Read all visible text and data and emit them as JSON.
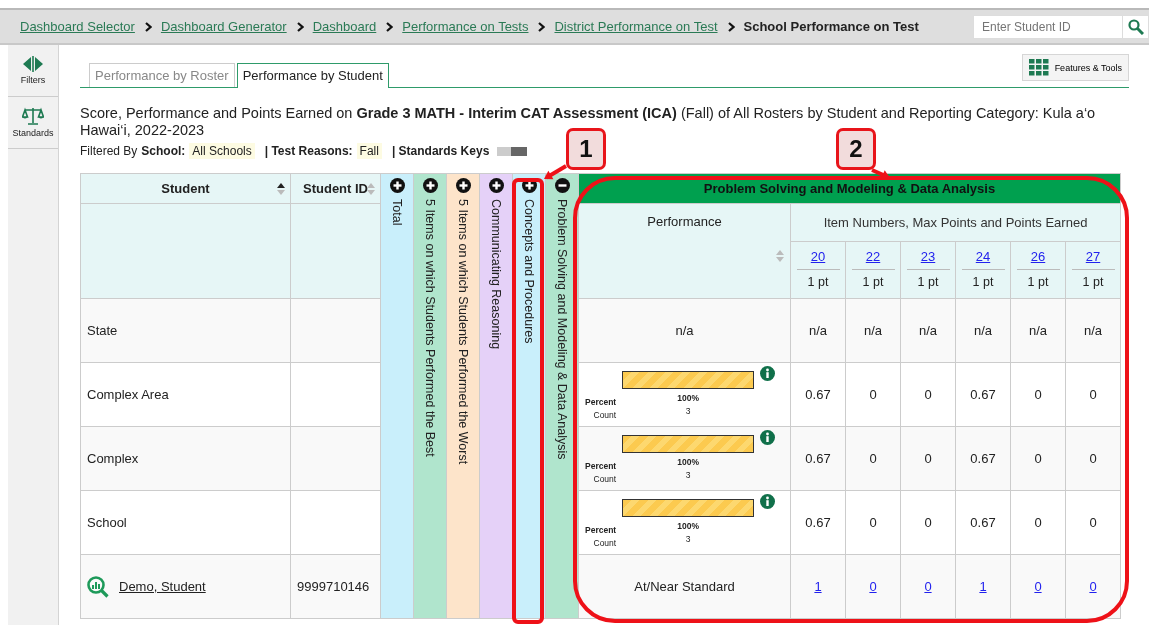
{
  "breadcrumbs": [
    {
      "label": "Dashboard Selector",
      "current": false
    },
    {
      "label": "Dashboard Generator",
      "current": false
    },
    {
      "label": "Dashboard",
      "current": false
    },
    {
      "label": "Performance on Tests",
      "current": false
    },
    {
      "label": "District Performance on Test",
      "current": false
    },
    {
      "label": "School Performance on Test",
      "current": true
    }
  ],
  "search": {
    "placeholder": "Enter Student ID"
  },
  "sidebar": {
    "items": [
      {
        "label": "Filters"
      },
      {
        "label": "Standards"
      }
    ]
  },
  "tabs": [
    {
      "label": "Performance by Roster",
      "selected": false
    },
    {
      "label": "Performance by Student",
      "selected": true
    }
  ],
  "features_button": {
    "label": "Features & Tools"
  },
  "title": "Score, Performance and Points Earned on **Grade 3 MATH - Interim CAT Assessment (ICA)** (Fall) of All Rosters by Student and Reporting Category: Kula a‘o Hawai‘i, 2022-2023",
  "filters": {
    "prefix": "Filtered By",
    "items": [
      {
        "label": "School:",
        "value": "All Schools"
      },
      {
        "label": "| Test Reasons:",
        "value": "Fall"
      }
    ],
    "standards_keys": {
      "label": "| Standards Keys",
      "on": false
    }
  },
  "table": {
    "columns": [
      {
        "label": "Student",
        "sorted": true
      },
      {
        "label": "Student ID",
        "sorted": false
      }
    ],
    "categories": [
      {
        "label": "Total",
        "color": "#c9effb",
        "expanded": false
      },
      {
        "label": "5 Items on which Students Performed the Best",
        "color": "#b0e5cd",
        "expanded": false
      },
      {
        "label": "5 Items on which Students Performed the Worst",
        "color": "#fde4ca",
        "expanded": false
      },
      {
        "label": "Communicating Reasoning",
        "color": "#e5d1f8",
        "expanded": false
      },
      {
        "label": "Concepts and Procedures",
        "color": "#c9effb",
        "expanded": false
      },
      {
        "label": "Problem Solving and Modeling & Data Analysis",
        "color": "#b0e5cd",
        "expanded": true
      }
    ],
    "group": {
      "title": "Problem Solving and Modeling & Data Analysis",
      "performance_header": {
        "label": "Performance",
        "sorted": false
      },
      "items_header": "Item Numbers, Max Points and Points Earned",
      "items": [
        {
          "number": "20",
          "points": "1 pt"
        },
        {
          "number": "22",
          "points": "1 pt"
        },
        {
          "number": "23",
          "points": "1 pt"
        },
        {
          "number": "24",
          "points": "1 pt"
        },
        {
          "number": "26",
          "points": "1 pt"
        },
        {
          "number": "27",
          "points": "1 pt"
        }
      ]
    },
    "rows": [
      {
        "kind": "aggregate",
        "name": "State",
        "performance": {
          "kind": "text",
          "text": "n/a"
        },
        "items": [
          "n/a",
          "n/a",
          "n/a",
          "n/a",
          "n/a",
          "n/a"
        ]
      },
      {
        "kind": "aggregate",
        "name": "Complex Area",
        "performance": {
          "kind": "bar",
          "level": 1,
          "percent_label": "Percent",
          "percent": "100%",
          "count_label": "Count",
          "count": "3"
        },
        "items": [
          "0.67",
          "0",
          "0",
          "0.67",
          "0",
          "0"
        ]
      },
      {
        "kind": "aggregate",
        "name": "Complex",
        "performance": {
          "kind": "bar",
          "level": 1,
          "percent_label": "Percent",
          "percent": "100%",
          "count_label": "Count",
          "count": "3"
        },
        "items": [
          "0.67",
          "0",
          "0",
          "0.67",
          "0",
          "0"
        ]
      },
      {
        "kind": "aggregate",
        "name": "School",
        "performance": {
          "kind": "bar",
          "level": 1,
          "percent_label": "Percent",
          "percent": "100%",
          "count_label": "Count",
          "count": "3"
        },
        "items": [
          "0.67",
          "0",
          "0",
          "0.67",
          "0",
          "0"
        ]
      },
      {
        "kind": "student",
        "name": "Demo, Student",
        "id": "9999710146",
        "performance": {
          "kind": "text",
          "text": "At/Near Standard"
        },
        "items": [
          "1",
          "0",
          "0",
          "1",
          "0",
          "0"
        ]
      }
    ]
  },
  "callouts": [
    {
      "label": "1"
    },
    {
      "label": "2"
    }
  ]
}
